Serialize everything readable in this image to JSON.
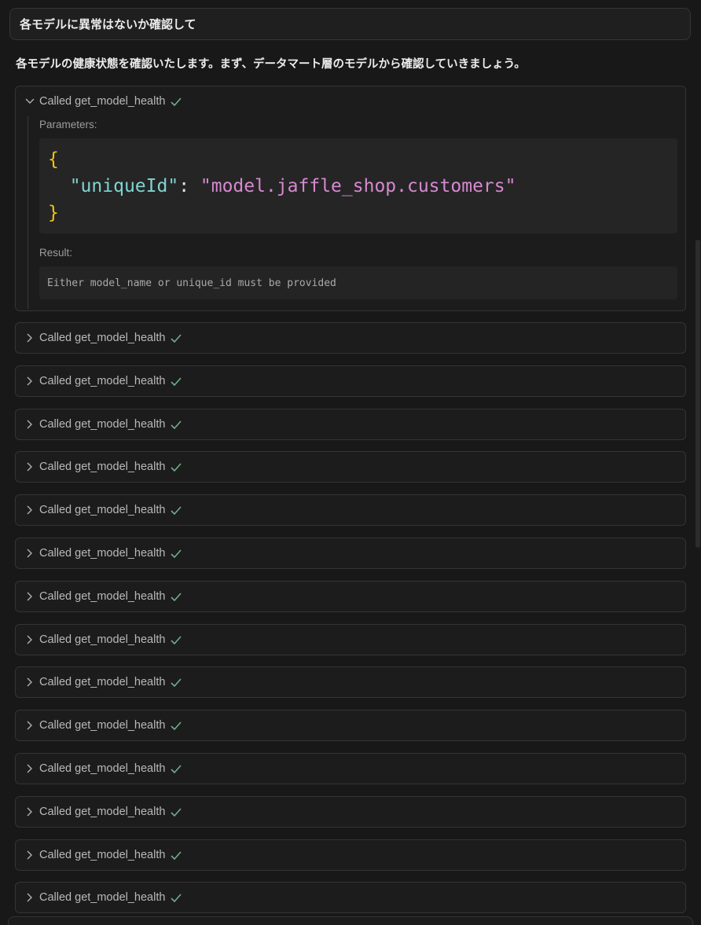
{
  "user_message": "各モデルに異常はないか確認して",
  "assistant_message": "各モデルの健康状態を確認いたします。まず、データマート層のモデルから確認していきましょう。",
  "tool_calls": [
    {
      "label": "Called get_model_health",
      "status": "success",
      "expanded": true,
      "parameters_label": "Parameters:",
      "parameters": {
        "key": "\"uniqueId\"",
        "value": "\"model.jaffle_shop.customers\""
      },
      "result_label": "Result:",
      "result": "Either model_name or unique_id must be provided"
    },
    {
      "label": "Called get_model_health",
      "status": "success",
      "expanded": false
    },
    {
      "label": "Called get_model_health",
      "status": "success",
      "expanded": false
    },
    {
      "label": "Called get_model_health",
      "status": "success",
      "expanded": false
    },
    {
      "label": "Called get_model_health",
      "status": "success",
      "expanded": false
    },
    {
      "label": "Called get_model_health",
      "status": "success",
      "expanded": false
    },
    {
      "label": "Called get_model_health",
      "status": "success",
      "expanded": false
    },
    {
      "label": "Called get_model_health",
      "status": "success",
      "expanded": false
    },
    {
      "label": "Called get_model_health",
      "status": "success",
      "expanded": false
    },
    {
      "label": "Called get_model_health",
      "status": "success",
      "expanded": false
    },
    {
      "label": "Called get_model_health",
      "status": "success",
      "expanded": false
    },
    {
      "label": "Called get_model_health",
      "status": "success",
      "expanded": false
    },
    {
      "label": "Called get_model_health",
      "status": "success",
      "expanded": false
    },
    {
      "label": "Called get_model_health",
      "status": "success",
      "expanded": false
    },
    {
      "label": "Called get_model_health",
      "status": "success",
      "expanded": false
    }
  ],
  "colors": {
    "background": "#181818",
    "check": "#6fae88",
    "json_brace": "#f1c40f",
    "json_key": "#7fd4d1",
    "json_string": "#d689d0"
  },
  "icons": {
    "expanded": "chevron-down-icon",
    "collapsed": "chevron-right-icon",
    "status": "check-icon"
  }
}
